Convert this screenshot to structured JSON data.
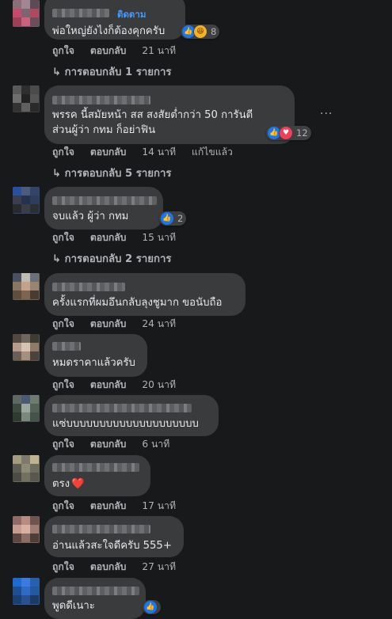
{
  "comments": [
    {
      "text": "พ่อใหญ่ยังไงก็ต้องคุกครับ",
      "follow_label": "ติดตาม",
      "reactions": [
        "like-icon",
        "haha-icon"
      ],
      "reaction_count": "8",
      "like_label": "ถูกใจ",
      "reply_label": "ตอบกลับ",
      "time": "21 นาที",
      "replies_label": "การตอบกลับ 1 รายการ"
    },
    {
      "text_line1": "พรรค นี้สมัยหน้า สส สงสัยต่ำกว่า 50 การันตี",
      "text_line2": "ส่วนผู้ว่า กทม ก็อย่าฟิน",
      "reactions": [
        "like-icon",
        "heart-icon"
      ],
      "reaction_count": "12",
      "like_label": "ถูกใจ",
      "reply_label": "ตอบกลับ",
      "time": "14 นาที",
      "edited_label": "แก้ไขแล้ว",
      "replies_label": "การตอบกลับ 5 รายการ",
      "more_label": "···"
    },
    {
      "text": "จบแล้ว ผู้ว่า กทม",
      "reactions": [
        "like-icon"
      ],
      "reaction_count": "2",
      "like_label": "ถูกใจ",
      "reply_label": "ตอบกลับ",
      "time": "15 นาที",
      "replies_label": "การตอบกลับ 2 รายการ"
    },
    {
      "text": "ครั้งแรกที่ผมอึนกลับลุงชูมาก ขอนับถือ",
      "like_label": "ถูกใจ",
      "reply_label": "ตอบกลับ",
      "time": "24 นาที"
    },
    {
      "text": "หมดราคาแล้วครับ",
      "like_label": "ถูกใจ",
      "reply_label": "ตอบกลับ",
      "time": "20 นาที"
    },
    {
      "text": "แซ่บบบบบบบบบบบบบบบบบบบบ",
      "like_label": "ถูกใจ",
      "reply_label": "ตอบกลับ",
      "time": "6 นาที"
    },
    {
      "text": "ตรง",
      "emoji": "❤️",
      "like_label": "ถูกใจ",
      "reply_label": "ตอบกลับ",
      "time": "17 นาที"
    },
    {
      "text": "อ่านแล้วสะใจดีครับ 555+",
      "like_label": "ถูกใจ",
      "reply_label": "ตอบกลับ",
      "time": "27 นาที"
    },
    {
      "text": "พูดดีเนาะ",
      "reactions": [
        "like-icon"
      ]
    }
  ],
  "icons": {
    "reply_arrow": "reply-arrow-icon",
    "like": "like-icon",
    "heart": "heart-icon",
    "haha": "haha-icon"
  },
  "colors": {
    "background": "#18191a",
    "bubble": "#3a3b3c",
    "text": "#e4e6eb",
    "secondary": "#b0b3b8",
    "link": "#4599ff",
    "like_blue": "#1877f2",
    "heart_red": "#f33e58"
  }
}
